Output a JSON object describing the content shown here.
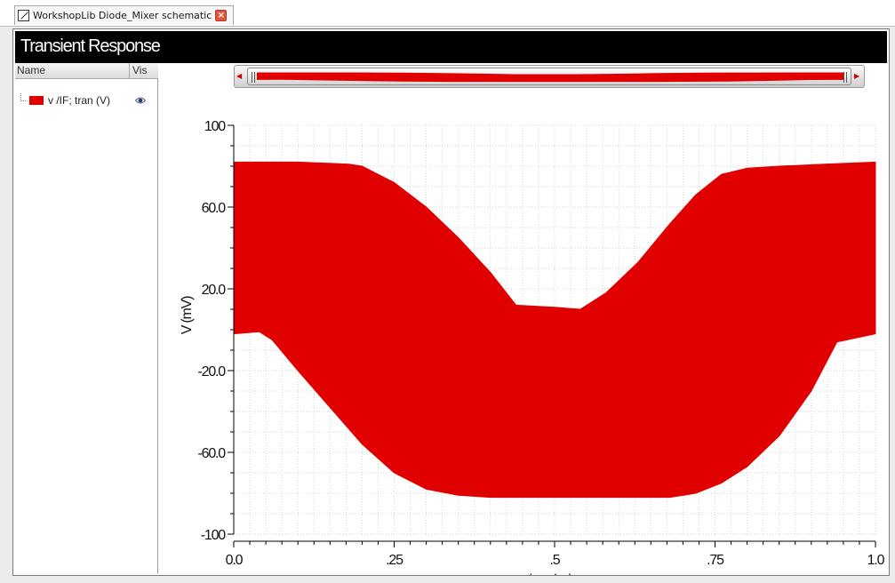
{
  "tab": {
    "label": "WorkshopLib Diode_Mixer schematic",
    "close_glyph": "×"
  },
  "title_bar": {
    "title": "Transient Response"
  },
  "legend": {
    "columns": {
      "name": "Name",
      "vis": "Vis"
    },
    "items": [
      {
        "label": "v /IF; tran (V)",
        "color": "#e00000",
        "visible": true
      }
    ]
  },
  "scrollbar": {
    "left_glyph": "◀",
    "right_glyph": "▶"
  },
  "chart_data": {
    "type": "area",
    "xlabel": "time (us)",
    "ylabel": "V (mV)",
    "xlim": [
      0.0,
      1.0
    ],
    "ylim": [
      -100,
      100
    ],
    "x_tick_labels": [
      "0.0",
      ".25",
      ".5",
      ".75",
      "1.0"
    ],
    "x_ticks": [
      0.0,
      0.25,
      0.5,
      0.75,
      1.0
    ],
    "y_tick_labels": [
      "100",
      "60.0",
      "20.0",
      "-20.0",
      "-60.0",
      "-100"
    ],
    "y_ticks": [
      100,
      60,
      20,
      -20,
      -60,
      -100
    ],
    "grid": true,
    "series": [
      {
        "color": "#e00000",
        "upper_envelope": {
          "x": [
            0.0,
            0.1,
            0.18,
            0.2,
            0.25,
            0.3,
            0.35,
            0.4,
            0.44,
            0.5,
            0.54,
            0.58,
            0.63,
            0.68,
            0.72,
            0.76,
            0.8,
            0.85,
            0.92,
            1.0
          ],
          "y": [
            82,
            82,
            81,
            80,
            72,
            60,
            45,
            28,
            12,
            11,
            10,
            18,
            33,
            52,
            66,
            76,
            79,
            80,
            81,
            82
          ]
        },
        "lower_envelope": {
          "x": [
            0.0,
            0.04,
            0.06,
            0.1,
            0.15,
            0.2,
            0.25,
            0.3,
            0.35,
            0.4,
            0.5,
            0.6,
            0.68,
            0.72,
            0.76,
            0.8,
            0.85,
            0.9,
            0.94,
            1.0
          ],
          "y": [
            -2,
            -1,
            -5,
            -20,
            -38,
            -56,
            -70,
            -78,
            -81,
            -82,
            -82,
            -82,
            -82,
            -80,
            -75,
            -67,
            -52,
            -30,
            -6,
            -2
          ]
        }
      }
    ]
  }
}
